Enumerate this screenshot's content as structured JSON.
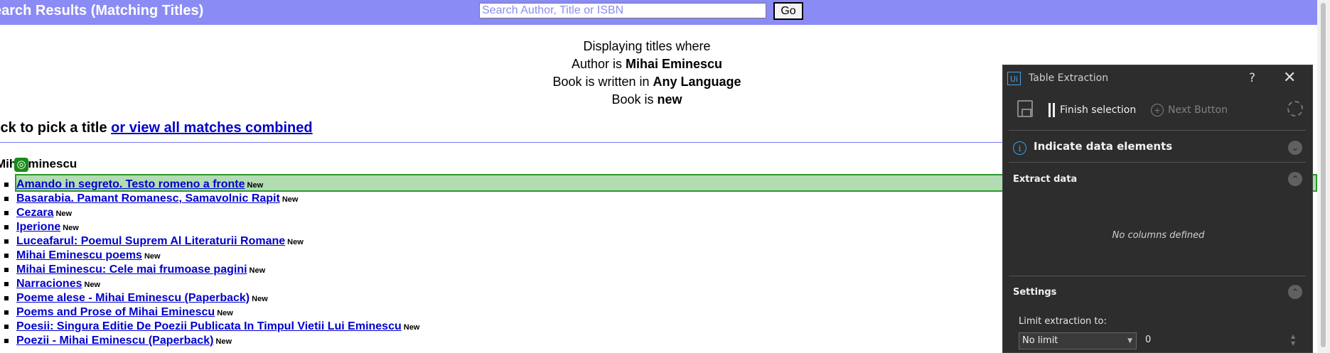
{
  "header": {
    "title": "earch Results (Matching Titles)",
    "search_placeholder": "Search Author, Title or ISBN",
    "go_label": "Go"
  },
  "criteria": {
    "intro": "Displaying titles where",
    "author_prefix": "Author is ",
    "author_value": "Mihai Eminescu",
    "language_prefix": "Book is written in ",
    "language_value": "Any Language",
    "condition_prefix": "Book is ",
    "condition_value": "new"
  },
  "pick": {
    "text": "ick to pick a title ",
    "link": "or view all matches combined"
  },
  "author_heading": "Mih Eminescu",
  "titles": [
    {
      "title": "Amando in segreto. Testo romeno a fronte",
      "badge": "New"
    },
    {
      "title": "Basarabia. Pamant Romanesc, Samavolnic Rapit",
      "badge": "New"
    },
    {
      "title": "Cezara",
      "badge": "New"
    },
    {
      "title": "Iperione",
      "badge": "New"
    },
    {
      "title": "Luceafarul: Poemul Suprem Al Literaturii Romane",
      "badge": "New"
    },
    {
      "title": "Mihai Eminescu poems",
      "badge": "New"
    },
    {
      "title": "Mihai Eminescu: Cele mai frumoase pagini",
      "badge": "New"
    },
    {
      "title": "Narraciones",
      "badge": "New"
    },
    {
      "title": "Poeme alese - Mihai Eminescu (Paperback)",
      "badge": "New"
    },
    {
      "title": "Poems and Prose of Mihai Eminescu",
      "badge": "New"
    },
    {
      "title": "Poesii: Singura Editie De Poezii Publicata In Timpul Vietii Lui Eminescu",
      "badge": "New"
    },
    {
      "title": "Poezii - Mihai Eminescu (Paperback)",
      "badge": "New"
    }
  ],
  "panel": {
    "logo": "Ui",
    "title": "Table Extraction",
    "help": "?",
    "close": "✕",
    "finish_label": "Finish selection",
    "next_label": "Next Button",
    "indicate_label": "Indicate data elements",
    "extract_label": "Extract data",
    "no_columns": "No columns defined",
    "settings_label": "Settings",
    "limit_label": "Limit extraction to:",
    "limit_value": "No limit",
    "limit_number": "0"
  }
}
